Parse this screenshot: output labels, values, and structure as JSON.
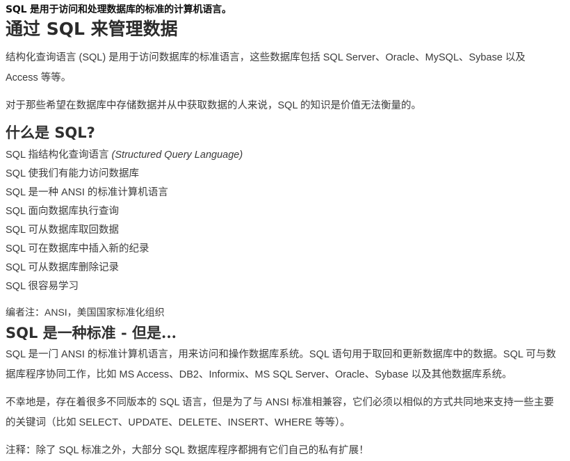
{
  "page": {
    "background": "#ffffff",
    "text_color": "#3a3a3a",
    "heading_color": "#2b2b2b"
  },
  "lead": "SQL 是用于访问和处理数据库的标准的计算机语言。",
  "title": {
    "before": "通过 ",
    "latin": "SQL",
    "after": " 来管理数据"
  },
  "intro": {
    "paragraph1": "结构化查询语言 (SQL) 是用于访问数据库的标准语言，这些数据库包括 SQL Server、Oracle、MySQL、Sybase 以及 Access 等等。",
    "paragraph2": "对于那些希望在数据库中存储数据并从中获取数据的人来说，SQL 的知识是价值无法衡量的。"
  },
  "what_is": {
    "heading": {
      "before": "什么是 ",
      "latin": "SQL?",
      "after": ""
    },
    "items": [
      {
        "text": "SQL 指结构化查询语言 ",
        "italic": "(Structured Query Language)"
      },
      {
        "text": "SQL 使我们有能力访问数据库",
        "italic": ""
      },
      {
        "text": "SQL 是一种 ANSI 的标准计算机语言",
        "italic": ""
      },
      {
        "text": "SQL 面向数据库执行查询",
        "italic": ""
      },
      {
        "text": "SQL 可从数据库取回数据",
        "italic": ""
      },
      {
        "text": "SQL 可在数据库中插入新的纪录",
        "italic": ""
      },
      {
        "text": "SQL 可从数据库删除记录",
        "italic": ""
      },
      {
        "text": "SQL 很容易学习",
        "italic": ""
      }
    ],
    "editor_note": "编者注：ANSI，美国国家标准化组织"
  },
  "standard": {
    "heading": {
      "before": "",
      "latin": "SQL",
      "after": " 是一种标准 - 但是..."
    },
    "paragraph1": "SQL 是一门 ANSI 的标准计算机语言，用来访问和操作数据库系统。SQL 语句用于取回和更新数据库中的数据。SQL 可与数据库程序协同工作，比如 MS Access、DB2、Informix、MS SQL Server、Oracle、Sybase 以及其他数据库系统。",
    "paragraph2": "不幸地是，存在着很多不同版本的 SQL 语言，但是为了与 ANSI 标准相兼容，它们必须以相似的方式共同地来支持一些主要的关键词（比如 SELECT、UPDATE、DELETE、INSERT、WHERE 等等）。",
    "footnote": "注释：除了 SQL 标准之外，大部分 SQL 数据库程序都拥有它们自己的私有扩展！"
  }
}
